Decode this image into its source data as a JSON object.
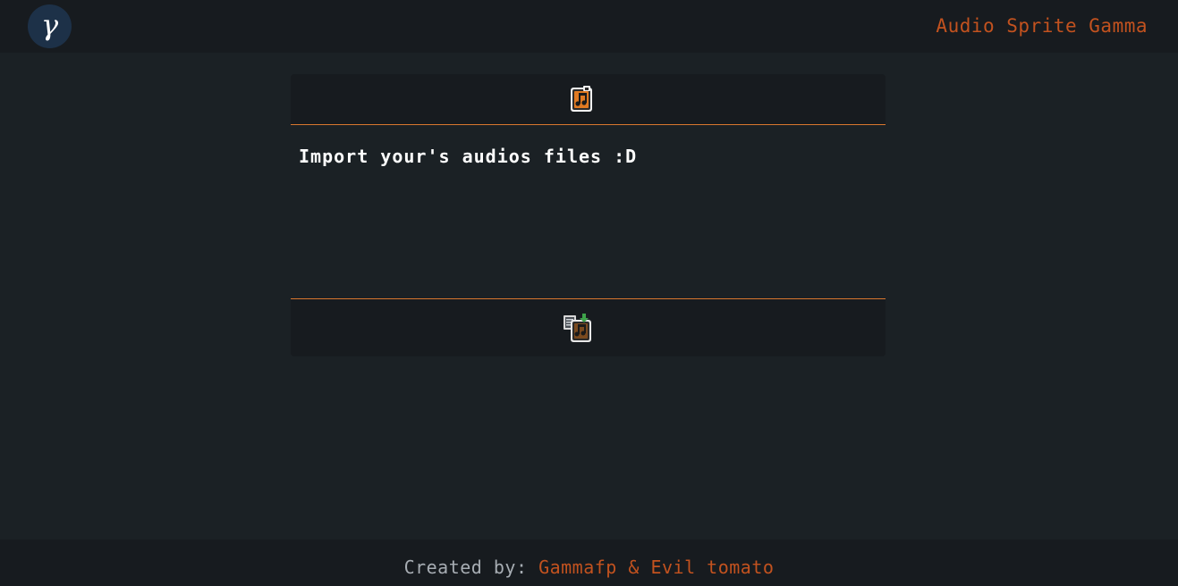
{
  "header": {
    "logo_glyph": "γ",
    "app_title": "Audio Sprite Gamma"
  },
  "panel": {
    "import_label": "Import your's audios files :D",
    "import_icon": "music-file-import-icon",
    "export_icon": "music-file-export-icon"
  },
  "footer": {
    "prefix": "Created by:",
    "authors": "Gammafp & Evil tomato"
  },
  "colors": {
    "accent": "#d9772e",
    "title": "#c2521f",
    "background": "#1b2125",
    "bar": "#171b1f",
    "logo_bg": "#1d3148"
  }
}
